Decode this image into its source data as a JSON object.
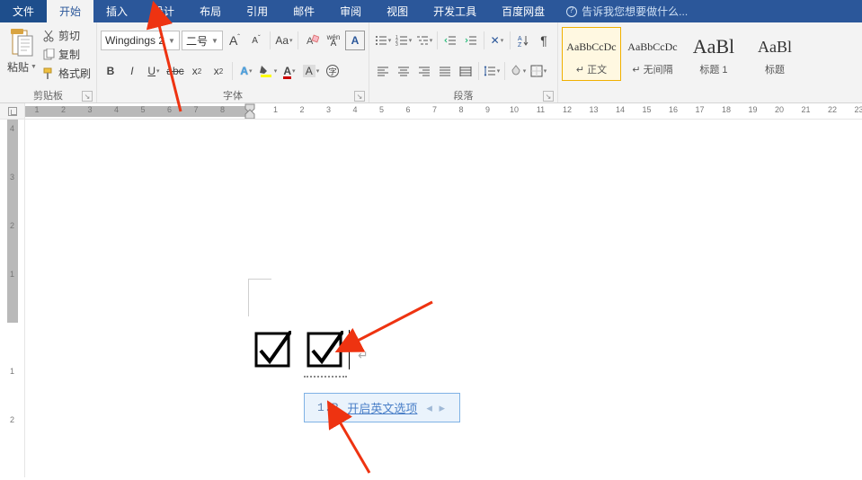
{
  "tabs": {
    "file": "文件",
    "home": "开始",
    "insert": "插入",
    "design": "设计",
    "layout": "布局",
    "references": "引用",
    "mailings": "邮件",
    "review": "审阅",
    "view": "视图",
    "developer": "开发工具",
    "baidu": "百度网盘",
    "tellme": "告诉我您想要做什么..."
  },
  "clipboard": {
    "paste": "粘贴",
    "cut": "剪切",
    "copy": "复制",
    "format_painter": "格式刷",
    "group": "剪贴板"
  },
  "font": {
    "name": "Wingdings 2",
    "size": "二号",
    "group": "字体",
    "phonetic": "wén"
  },
  "paragraph": {
    "group": "段落"
  },
  "styles": {
    "items": [
      {
        "preview": "AaBbCcDc",
        "name": "↵ 正文",
        "size": "12",
        "sel": true
      },
      {
        "preview": "AaBbCcDc",
        "name": "↵ 无间隔",
        "size": "12",
        "sel": false
      },
      {
        "preview": "AaBl",
        "name": "标题 1",
        "size": "22",
        "sel": false
      },
      {
        "preview": "AaBl",
        "name": "标题",
        "size": "18",
        "sel": false
      }
    ]
  },
  "ime": {
    "idx": "1.R",
    "link": "开启英文选项",
    "pager": "◂ ▸"
  },
  "ruler": {
    "h_neg": [
      "8",
      "7",
      "6",
      "5",
      "4",
      "3",
      "2",
      "1"
    ],
    "h_pos": [
      "1",
      "2",
      "3",
      "4",
      "5",
      "6",
      "7",
      "8",
      "9",
      "10",
      "11",
      "12",
      "13",
      "14",
      "15",
      "16",
      "17",
      "18",
      "19",
      "20",
      "21",
      "22",
      "23"
    ],
    "v": [
      "4",
      "3",
      "2",
      "1",
      "1",
      "2"
    ]
  }
}
